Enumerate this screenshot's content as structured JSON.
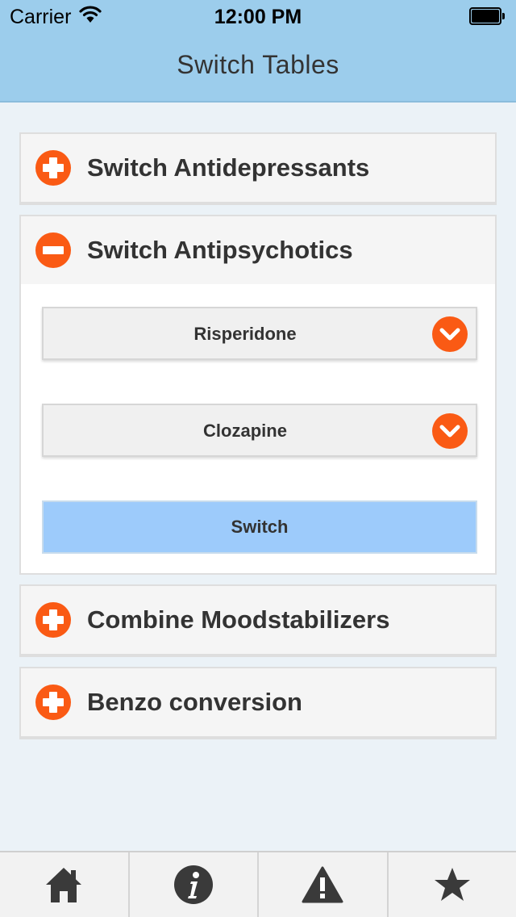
{
  "status_bar": {
    "carrier": "Carrier",
    "time": "12:00 PM"
  },
  "nav": {
    "title": "Switch Tables"
  },
  "accordion": {
    "sections": [
      {
        "label": "Switch Antidepressants",
        "state": "collapsed"
      },
      {
        "label": "Switch Antipsychotics",
        "state": "expanded"
      },
      {
        "label": "Combine Moodstabilizers",
        "state": "collapsed"
      },
      {
        "label": "Benzo conversion",
        "state": "collapsed"
      }
    ],
    "antipsychotics_form": {
      "from_value": "Risperidone",
      "to_value": "Clozapine",
      "switch_label": "Switch"
    }
  },
  "tabbar": {
    "tabs": [
      {
        "icon": "home-icon"
      },
      {
        "icon": "info-icon"
      },
      {
        "icon": "warning-icon"
      },
      {
        "icon": "star-icon"
      }
    ]
  },
  "colors": {
    "header_bg": "#9ccdec",
    "accent_orange": "#fa5a14",
    "switch_button_bg": "#9dcbfb",
    "page_bg": "#ebf2f7"
  }
}
